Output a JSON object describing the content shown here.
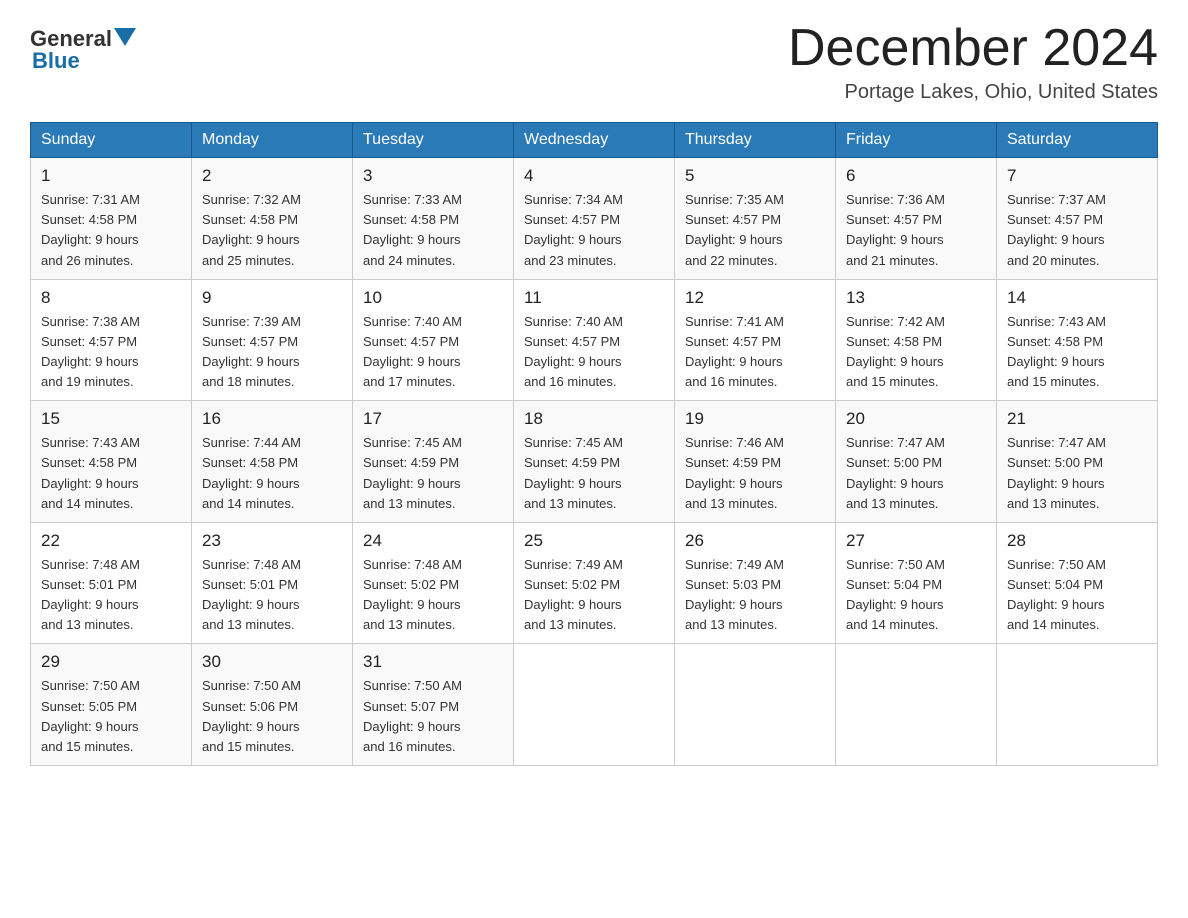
{
  "header": {
    "title": "December 2024",
    "subtitle": "Portage Lakes, Ohio, United States",
    "logo_general": "General",
    "logo_blue": "Blue"
  },
  "days_of_week": [
    "Sunday",
    "Monday",
    "Tuesday",
    "Wednesday",
    "Thursday",
    "Friday",
    "Saturday"
  ],
  "weeks": [
    [
      {
        "day": "1",
        "sunrise": "7:31 AM",
        "sunset": "4:58 PM",
        "daylight": "9 hours and 26 minutes."
      },
      {
        "day": "2",
        "sunrise": "7:32 AM",
        "sunset": "4:58 PM",
        "daylight": "9 hours and 25 minutes."
      },
      {
        "day": "3",
        "sunrise": "7:33 AM",
        "sunset": "4:58 PM",
        "daylight": "9 hours and 24 minutes."
      },
      {
        "day": "4",
        "sunrise": "7:34 AM",
        "sunset": "4:57 PM",
        "daylight": "9 hours and 23 minutes."
      },
      {
        "day": "5",
        "sunrise": "7:35 AM",
        "sunset": "4:57 PM",
        "daylight": "9 hours and 22 minutes."
      },
      {
        "day": "6",
        "sunrise": "7:36 AM",
        "sunset": "4:57 PM",
        "daylight": "9 hours and 21 minutes."
      },
      {
        "day": "7",
        "sunrise": "7:37 AM",
        "sunset": "4:57 PM",
        "daylight": "9 hours and 20 minutes."
      }
    ],
    [
      {
        "day": "8",
        "sunrise": "7:38 AM",
        "sunset": "4:57 PM",
        "daylight": "9 hours and 19 minutes."
      },
      {
        "day": "9",
        "sunrise": "7:39 AM",
        "sunset": "4:57 PM",
        "daylight": "9 hours and 18 minutes."
      },
      {
        "day": "10",
        "sunrise": "7:40 AM",
        "sunset": "4:57 PM",
        "daylight": "9 hours and 17 minutes."
      },
      {
        "day": "11",
        "sunrise": "7:40 AM",
        "sunset": "4:57 PM",
        "daylight": "9 hours and 16 minutes."
      },
      {
        "day": "12",
        "sunrise": "7:41 AM",
        "sunset": "4:57 PM",
        "daylight": "9 hours and 16 minutes."
      },
      {
        "day": "13",
        "sunrise": "7:42 AM",
        "sunset": "4:58 PM",
        "daylight": "9 hours and 15 minutes."
      },
      {
        "day": "14",
        "sunrise": "7:43 AM",
        "sunset": "4:58 PM",
        "daylight": "9 hours and 15 minutes."
      }
    ],
    [
      {
        "day": "15",
        "sunrise": "7:43 AM",
        "sunset": "4:58 PM",
        "daylight": "9 hours and 14 minutes."
      },
      {
        "day": "16",
        "sunrise": "7:44 AM",
        "sunset": "4:58 PM",
        "daylight": "9 hours and 14 minutes."
      },
      {
        "day": "17",
        "sunrise": "7:45 AM",
        "sunset": "4:59 PM",
        "daylight": "9 hours and 13 minutes."
      },
      {
        "day": "18",
        "sunrise": "7:45 AM",
        "sunset": "4:59 PM",
        "daylight": "9 hours and 13 minutes."
      },
      {
        "day": "19",
        "sunrise": "7:46 AM",
        "sunset": "4:59 PM",
        "daylight": "9 hours and 13 minutes."
      },
      {
        "day": "20",
        "sunrise": "7:47 AM",
        "sunset": "5:00 PM",
        "daylight": "9 hours and 13 minutes."
      },
      {
        "day": "21",
        "sunrise": "7:47 AM",
        "sunset": "5:00 PM",
        "daylight": "9 hours and 13 minutes."
      }
    ],
    [
      {
        "day": "22",
        "sunrise": "7:48 AM",
        "sunset": "5:01 PM",
        "daylight": "9 hours and 13 minutes."
      },
      {
        "day": "23",
        "sunrise": "7:48 AM",
        "sunset": "5:01 PM",
        "daylight": "9 hours and 13 minutes."
      },
      {
        "day": "24",
        "sunrise": "7:48 AM",
        "sunset": "5:02 PM",
        "daylight": "9 hours and 13 minutes."
      },
      {
        "day": "25",
        "sunrise": "7:49 AM",
        "sunset": "5:02 PM",
        "daylight": "9 hours and 13 minutes."
      },
      {
        "day": "26",
        "sunrise": "7:49 AM",
        "sunset": "5:03 PM",
        "daylight": "9 hours and 13 minutes."
      },
      {
        "day": "27",
        "sunrise": "7:50 AM",
        "sunset": "5:04 PM",
        "daylight": "9 hours and 14 minutes."
      },
      {
        "day": "28",
        "sunrise": "7:50 AM",
        "sunset": "5:04 PM",
        "daylight": "9 hours and 14 minutes."
      }
    ],
    [
      {
        "day": "29",
        "sunrise": "7:50 AM",
        "sunset": "5:05 PM",
        "daylight": "9 hours and 15 minutes."
      },
      {
        "day": "30",
        "sunrise": "7:50 AM",
        "sunset": "5:06 PM",
        "daylight": "9 hours and 15 minutes."
      },
      {
        "day": "31",
        "sunrise": "7:50 AM",
        "sunset": "5:07 PM",
        "daylight": "9 hours and 16 minutes."
      },
      null,
      null,
      null,
      null
    ]
  ],
  "labels": {
    "sunrise": "Sunrise:",
    "sunset": "Sunset:",
    "daylight": "Daylight:"
  }
}
